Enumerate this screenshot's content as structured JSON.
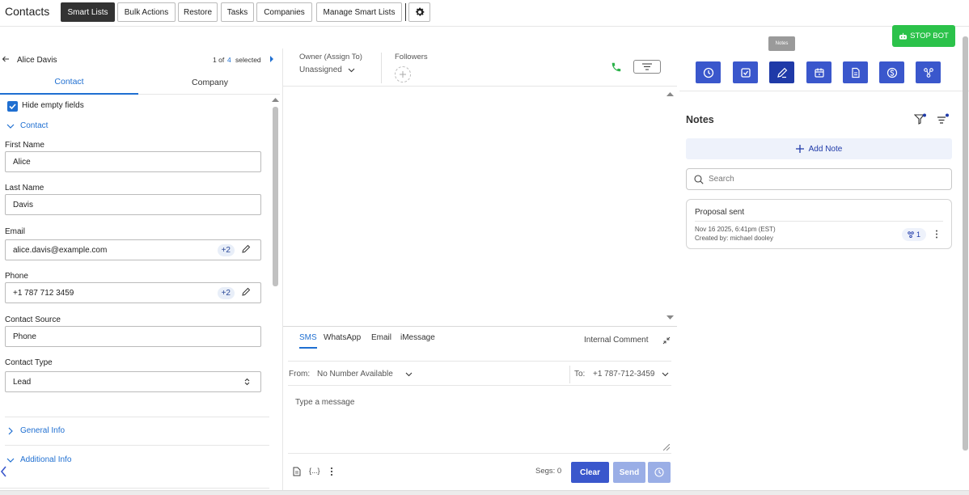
{
  "topbar": {
    "title": "Contacts",
    "tabs": [
      "Smart Lists",
      "Bulk Actions",
      "Restore",
      "Tasks",
      "Companies",
      "Manage Smart Lists"
    ]
  },
  "bot": {
    "stop_label": "STOP BOT",
    "color": "#2bc24a"
  },
  "tooltip": "Notes",
  "contact_header": {
    "name": "Alice Davis",
    "pager_prefix": "1 of",
    "pager_count": "4",
    "pager_suffix": "selected"
  },
  "left_tabs": {
    "contact": "Contact",
    "company": "Company"
  },
  "hide_empty": {
    "label": "Hide empty fields",
    "checked": true
  },
  "section_contact": "Contact",
  "fields": {
    "first_name": {
      "label": "First Name",
      "value": "Alice"
    },
    "last_name": {
      "label": "Last Name",
      "value": "Davis"
    },
    "email": {
      "label": "Email",
      "value": "alice.davis@example.com",
      "extra": "+2"
    },
    "phone": {
      "label": "Phone",
      "value": "+1 787 712 3459",
      "extra": "+2"
    },
    "contact_source": {
      "label": "Contact Source",
      "value": "Phone"
    },
    "contact_type": {
      "label": "Contact Type",
      "value": "Lead"
    }
  },
  "sections": {
    "general": "General Info",
    "additional": "Additional Info"
  },
  "owner": {
    "label": "Owner (Assign To)",
    "value": "Unassigned"
  },
  "followers": {
    "label": "Followers"
  },
  "composer": {
    "channels": [
      "SMS",
      "WhatsApp",
      "Email",
      "iMessage"
    ],
    "active_channel": "SMS",
    "internal_comment": "Internal Comment",
    "from_label": "From:",
    "from_value": "No Number Available",
    "to_label": "To:",
    "to_value": "+1 787-712-3459",
    "placeholder": "Type a message",
    "segs": "Segs: 0",
    "clear": "Clear",
    "send": "Send"
  },
  "notes": {
    "title": "Notes",
    "add_label": "Add Note",
    "search_placeholder": "Search",
    "items": [
      {
        "title": "Proposal sent",
        "date": "Nov 16 2025, 6:41pm (EST)",
        "created_by": "Created by: michael dooley",
        "badge": "1"
      }
    ]
  },
  "colors": {
    "primary": "#3a57cc",
    "accent_blue": "#1f6fd1",
    "green": "#2bc24a"
  }
}
